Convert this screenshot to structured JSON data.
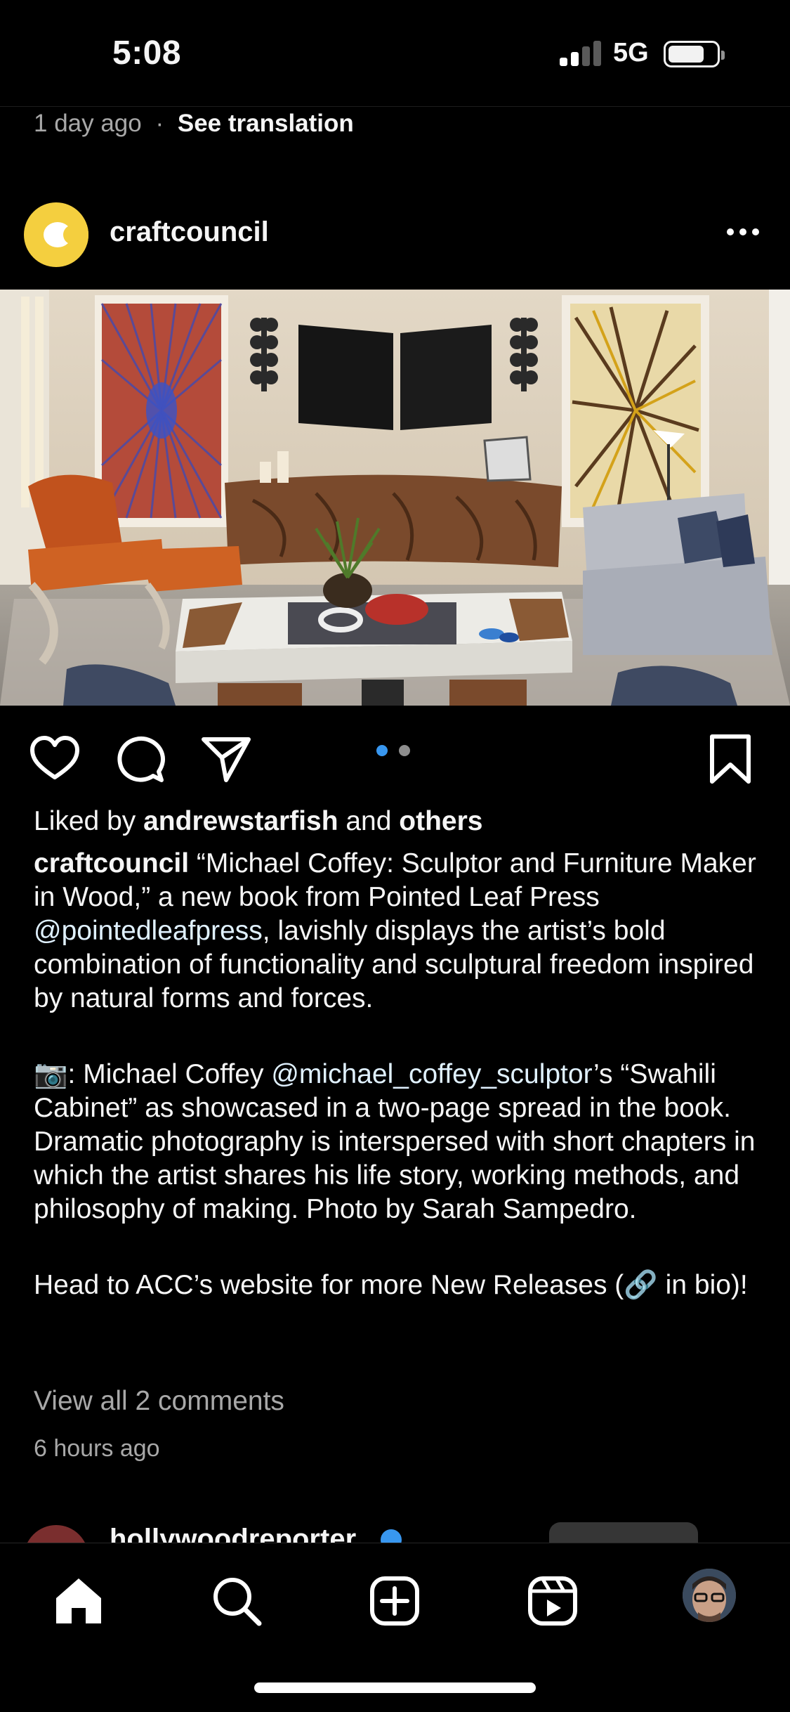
{
  "status_bar": {
    "time": "5:08",
    "network": "5G"
  },
  "previous_post": {
    "time_ago": "1 day ago",
    "separator": "·",
    "see_translation": "See translation"
  },
  "post": {
    "username": "craftcouncil",
    "more_label": "•••",
    "photo_alt": "Living room spread with sculpted wooden cabinet, orange lounge chair and abstract art",
    "carousel": {
      "count": 2,
      "active": 0,
      "active_color": "#3897f0",
      "inactive_color": "#8e8e8e"
    },
    "likes": {
      "prefix": "Liked by ",
      "user": "andrewstarfish",
      "middle": " and ",
      "others": "others"
    },
    "caption": {
      "author": "craftcouncil",
      "p1_a": " “Michael Coffey: Sculptor and Furniture Maker in Wood,” a new book from Pointed Leaf Press ",
      "p1_mention": "@pointedleafpress",
      "p1_b": ", lavishly displays the artist’s bold combination of functionality and sculptural freedom inspired by natural forms and forces.",
      "p2_a": "📷: Michael Coffey ",
      "p2_mention": "@michael_coffey_sculptor",
      "p2_b": "’s “Swahili Cabinet” as showcased in a two-page spread in the book. Dramatic photography is interspersed with short chapters in which the artist shares his life story, working methods, and philosophy of making. Photo by Sarah Sampedro.",
      "p3": "Head to ACC’s website for more New Releases (🔗 in bio)!"
    },
    "view_comments": "View all 2 comments",
    "time_ago": "6 hours ago"
  },
  "next_post": {
    "username": "hollywoodreporter"
  },
  "tab_bar": {
    "items": [
      "home-icon",
      "search-icon",
      "create-post-icon",
      "reels-icon",
      "profile-avatar"
    ]
  }
}
